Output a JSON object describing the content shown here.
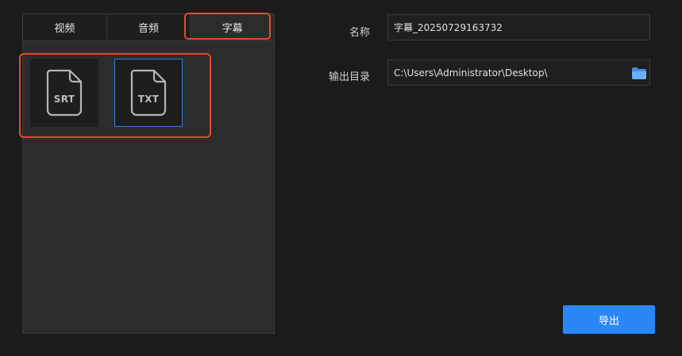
{
  "tabs": [
    {
      "label": "视频",
      "active": false
    },
    {
      "label": "音频",
      "active": false
    },
    {
      "label": "字幕",
      "active": true
    }
  ],
  "formats": [
    {
      "label": "SRT",
      "selected": false
    },
    {
      "label": "TXT",
      "selected": true
    }
  ],
  "form": {
    "name_label": "名称",
    "name_value": "字幕_20250729163732",
    "dir_label": "输出目录",
    "dir_value": "C:\\Users\\Administrator\\Desktop\\"
  },
  "export_label": "导出",
  "colors": {
    "accent": "#2b87f5",
    "highlight": "#e44c2e",
    "selected_border": "#2f7fe0"
  },
  "icons": {
    "folder": "folder-icon",
    "file": "file-icon"
  }
}
